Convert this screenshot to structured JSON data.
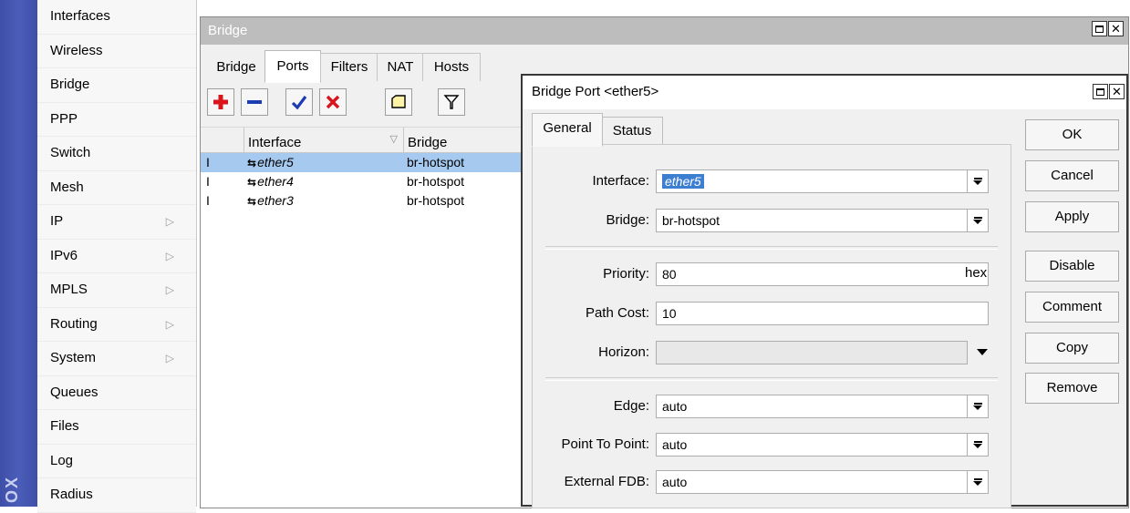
{
  "strip_text": "OX",
  "left_menu": {
    "items": [
      {
        "label": "Interfaces",
        "has_arrow": false
      },
      {
        "label": "Wireless",
        "has_arrow": false
      },
      {
        "label": "Bridge",
        "has_arrow": false
      },
      {
        "label": "PPP",
        "has_arrow": false
      },
      {
        "label": "Switch",
        "has_arrow": false
      },
      {
        "label": "Mesh",
        "has_arrow": false
      },
      {
        "label": "IP",
        "has_arrow": true
      },
      {
        "label": "IPv6",
        "has_arrow": true
      },
      {
        "label": "MPLS",
        "has_arrow": true
      },
      {
        "label": "Routing",
        "has_arrow": true
      },
      {
        "label": "System",
        "has_arrow": true
      },
      {
        "label": "Queues",
        "has_arrow": false
      },
      {
        "label": "Files",
        "has_arrow": false
      },
      {
        "label": "Log",
        "has_arrow": false
      },
      {
        "label": "Radius",
        "has_arrow": false
      }
    ],
    "arrow_glyph": "▷"
  },
  "bridge_window": {
    "title": "Bridge",
    "tabs": [
      "Bridge",
      "Ports",
      "Filters",
      "NAT",
      "Hosts"
    ],
    "active_tab": "Ports",
    "toolbar": [
      {
        "name": "add-icon",
        "glyph": "+"
      },
      {
        "name": "remove-icon",
        "glyph": "−"
      },
      {
        "name": "enable-icon",
        "glyph": "✔"
      },
      {
        "name": "disable-icon",
        "glyph": "✖"
      },
      {
        "name": "comment-icon",
        "glyph": ""
      },
      {
        "name": "filter-icon",
        "glyph": "⏷"
      }
    ],
    "grid": {
      "columns": [
        "Interface",
        "Bridge"
      ],
      "sort_glyph": "▽",
      "rows": [
        {
          "flag": "I",
          "interface": "ether5",
          "bridge": "br-hotspot",
          "selected": true
        },
        {
          "flag": "I",
          "interface": "ether4",
          "bridge": "br-hotspot",
          "selected": false
        },
        {
          "flag": "I",
          "interface": "ether3",
          "bridge": "br-hotspot",
          "selected": false
        }
      ],
      "iface_icon": "⇆"
    }
  },
  "port_dialog": {
    "title": "Bridge Port <ether5>",
    "tabs": [
      "General",
      "Status"
    ],
    "active_tab": "General",
    "fields": {
      "interface": {
        "label": "Interface:",
        "value": "ether5"
      },
      "bridge": {
        "label": "Bridge:",
        "value": "br-hotspot"
      },
      "priority": {
        "label": "Priority:",
        "value": "80",
        "suffix": "hex"
      },
      "path_cost": {
        "label": "Path Cost:",
        "value": "10"
      },
      "horizon": {
        "label": "Horizon:",
        "value": ""
      },
      "edge": {
        "label": "Edge:",
        "value": "auto"
      },
      "point_to_point": {
        "label": "Point To Point:",
        "value": "auto"
      },
      "external_fdb": {
        "label": "External FDB:",
        "value": "auto"
      }
    },
    "buttons": {
      "ok": "OK",
      "cancel": "Cancel",
      "apply": "Apply",
      "disable": "Disable",
      "comment": "Comment",
      "copy": "Copy",
      "remove": "Remove"
    }
  },
  "colors": {
    "strip_blue": "#4a5db8",
    "selection_blue": "#a6c9ef",
    "add_red": "#d9141b",
    "remove_blue": "#1d3bb3",
    "check_blue": "#1d3bb3",
    "x_red": "#d9141b"
  }
}
